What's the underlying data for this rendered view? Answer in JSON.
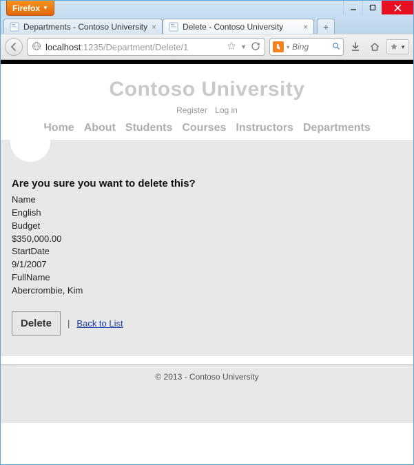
{
  "window": {
    "firefox_menu": "Firefox"
  },
  "tabs": [
    {
      "label": "Departments - Contoso University",
      "active": false
    },
    {
      "label": "Delete - Contoso University",
      "active": true
    }
  ],
  "url": {
    "host": "localhost",
    "path": ":1235/Department/Delete/1"
  },
  "search": {
    "placeholder": "Bing"
  },
  "site": {
    "title": "Contoso University",
    "register": "Register",
    "login": "Log in",
    "nav": [
      "Home",
      "About",
      "Students",
      "Courses",
      "Instructors",
      "Departments"
    ]
  },
  "page": {
    "confirm": "Are you sure you want to delete this?",
    "fields": [
      {
        "label": "Name",
        "value": "English"
      },
      {
        "label": "Budget",
        "value": "$350,000.00"
      },
      {
        "label": "StartDate",
        "value": "9/1/2007"
      },
      {
        "label": "FullName",
        "value": "Abercrombie, Kim"
      }
    ],
    "delete_btn": "Delete",
    "back_link": "Back to List"
  },
  "footer": "© 2013 - Contoso University"
}
